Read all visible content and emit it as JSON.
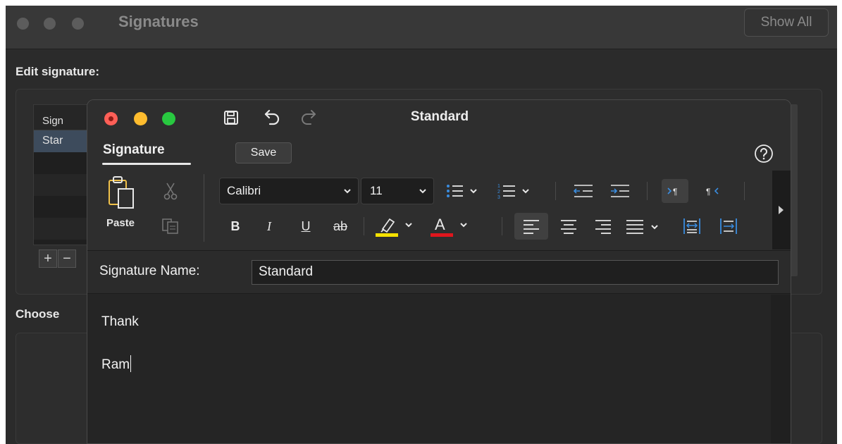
{
  "background_window": {
    "title": "Signatures",
    "show_all_label": "Show All",
    "edit_label": "Edit signature:",
    "choose_label": "Choose",
    "list_header": "Sign",
    "list_selected": "Star",
    "plus_label": "+",
    "minus_label": "−"
  },
  "editor": {
    "title": "Standard",
    "tab_label": "Signature",
    "save_label": "Save",
    "paste_label": "Paste",
    "font_name": "Calibri",
    "font_size": "11",
    "bold_label": "B",
    "italic_label": "I",
    "underline_label": "U",
    "strike_label": "ab",
    "signature_name_label": "Signature Name:",
    "signature_name_value": "Standard",
    "body_lines": [
      "Thank",
      "Ram"
    ]
  },
  "colors": {
    "highlight": "#f5e100",
    "font_color": "#e0161d",
    "accent_blue": "#3a8de0"
  }
}
